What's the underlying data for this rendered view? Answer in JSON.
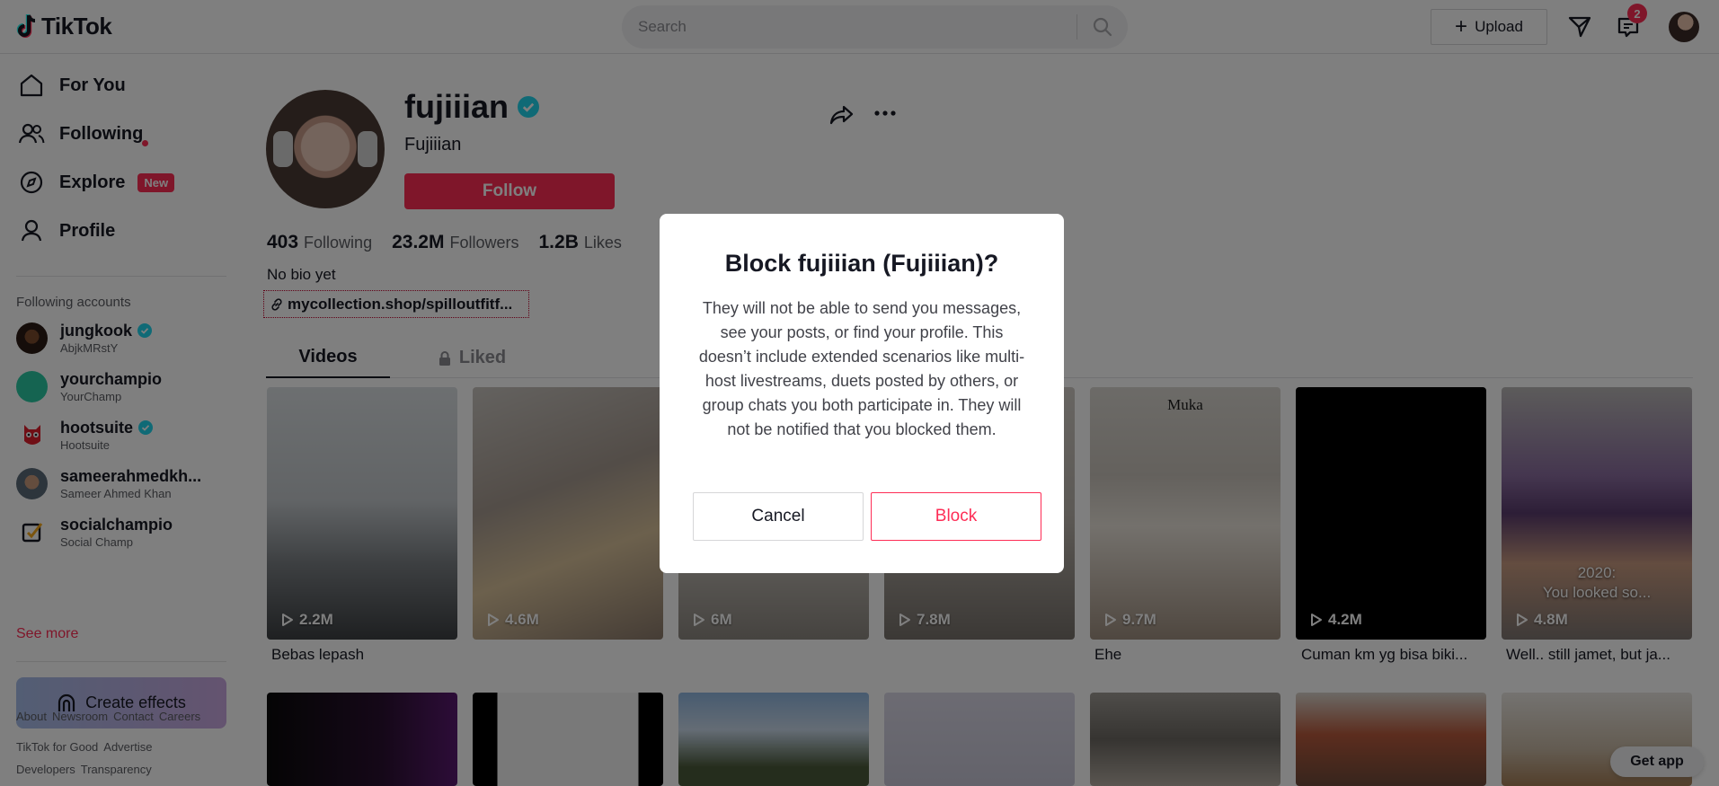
{
  "header": {
    "logo_text": "TikTok",
    "search_placeholder": "Search",
    "upload_label": "Upload",
    "inbox_count": "2"
  },
  "sidebar": {
    "nav": [
      {
        "label": "For You",
        "icon": "home-icon"
      },
      {
        "label": "Following",
        "icon": "users-icon"
      },
      {
        "label": "Explore",
        "icon": "compass-icon",
        "badge": "New"
      },
      {
        "label": "Profile",
        "icon": "person-icon"
      }
    ],
    "following_heading": "Following accounts",
    "accounts": [
      {
        "username": "jungkook",
        "display": "AbjkMRstY",
        "verified": true
      },
      {
        "username": "yourchampio",
        "display": "YourChamp",
        "verified": false
      },
      {
        "username": "hootsuite",
        "display": "Hootsuite",
        "verified": true
      },
      {
        "username": "sameerahmedkh...",
        "display": "Sameer Ahmed Khan",
        "verified": false
      },
      {
        "username": "socialchampio",
        "display": "Social Champ",
        "verified": false
      }
    ],
    "see_more": "See more",
    "effects_label": "Create effects",
    "footer_rows": [
      [
        "About",
        "Newsroom",
        "Contact",
        "Careers"
      ],
      [
        "TikTok for Good",
        "Advertise"
      ],
      [
        "Developers",
        "Transparency"
      ]
    ]
  },
  "profile": {
    "username": "fujiiian",
    "nickname": "Fujiiian",
    "follow_label": "Follow",
    "following_count": "403",
    "following_label": "Following",
    "followers_count": "23.2M",
    "followers_label": "Followers",
    "likes_count": "1.2B",
    "likes_label": "Likes",
    "bio": "No bio yet",
    "link": "mycollection.shop/spilloutfitf..."
  },
  "tabs": {
    "videos": "Videos",
    "liked": "Liked"
  },
  "videos": [
    {
      "views": "2.2M",
      "caption": "Bebas lepash",
      "overlay": ""
    },
    {
      "views": "4.6M",
      "caption": "",
      "overlay": ""
    },
    {
      "views": "6M",
      "caption": "",
      "overlay": ""
    },
    {
      "views": "7.8M",
      "caption": "",
      "overlay": ""
    },
    {
      "views": "9.7M",
      "caption": "Ehe",
      "overlay": "Muka"
    },
    {
      "views": "4.2M",
      "caption": "Cuman km yg bisa biki...",
      "overlay": ""
    },
    {
      "views": "4.8M",
      "caption": "Well.. still jamet, but ja...",
      "overlay": "2020:\nYou looked so..."
    }
  ],
  "get_app": "Get app",
  "modal": {
    "title": "Block fujiiian (Fujiiian)?",
    "body": "They will not be able to send you messages, see your posts, or find your profile. This doesn’t include extended scenarios like multi-host livestreams, duets posted by others, or group chats you both participate in. They will not be notified that you blocked them.",
    "cancel_label": "Cancel",
    "block_label": "Block"
  },
  "colors": {
    "brand": "#fe2c55",
    "verified": "#20d5ec"
  }
}
